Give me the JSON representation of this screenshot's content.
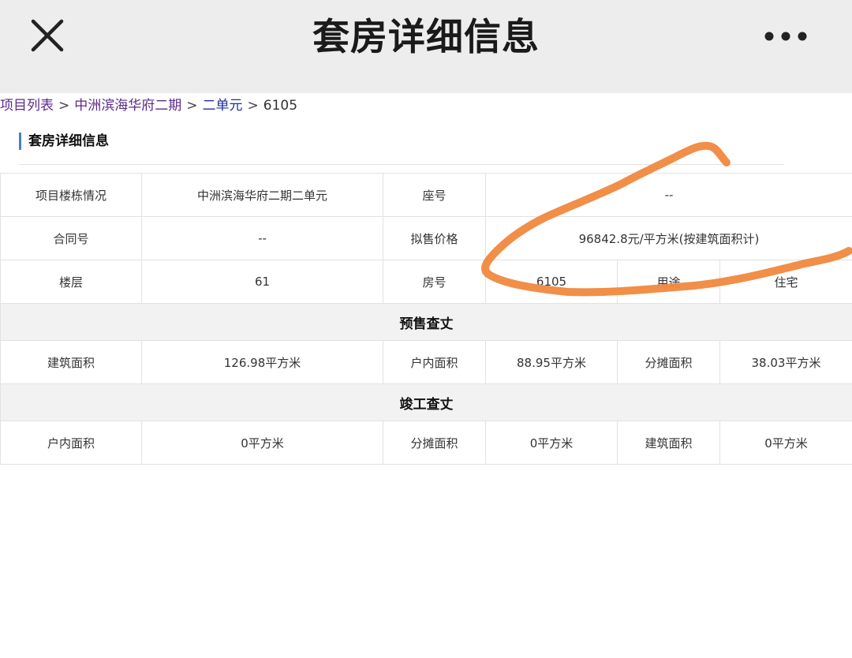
{
  "header": {
    "title": "套房详细信息",
    "close_icon": "close-icon",
    "more_icon": "more-horizontal-icon"
  },
  "breadcrumb": {
    "items": [
      "项目列表",
      "中洲滨海华府二期",
      "二单元",
      "6105"
    ],
    "separator": ">"
  },
  "section": {
    "title": "套房详细信息"
  },
  "table": {
    "row1": [
      "项目楼栋情况",
      "中洲滨海华府二期二单元",
      "座号",
      "--"
    ],
    "row2": [
      "合同号",
      "--",
      "拟售价格",
      "96842.8元/平方米(按建筑面积计)"
    ],
    "row3": [
      "楼层",
      "61",
      "房号",
      "6105",
      "用途",
      "住宅"
    ],
    "presale_header": "预售查丈",
    "presale_row": [
      "建筑面积",
      "126.98平方米",
      "户内面积",
      "88.95平方米",
      "分摊面积",
      "38.03平方米"
    ],
    "completion_header": "竣工查丈",
    "completion_row": [
      "户内面积",
      "0平方米",
      "分摊面积",
      "0平方米",
      "建筑面积",
      "0平方米"
    ]
  },
  "colors": {
    "topbar": "#ededed",
    "accent_bar": "#4a7fc1",
    "scribble": "#f0883e"
  }
}
